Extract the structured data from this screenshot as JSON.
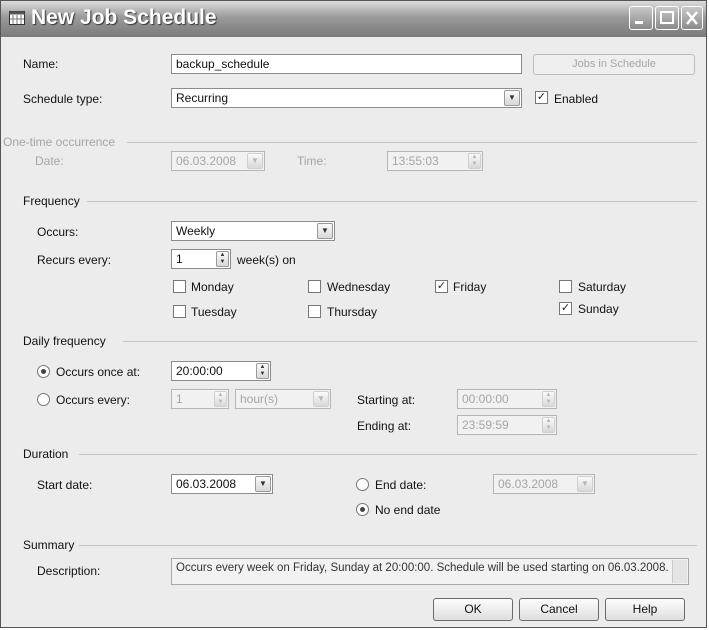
{
  "window": {
    "title": "New Job Schedule"
  },
  "general": {
    "name_label": "Name:",
    "name_value": "backup_schedule",
    "jobs_button": "Jobs in Schedule",
    "schedule_type_label": "Schedule type:",
    "schedule_type_value": "Recurring",
    "enabled_label": "Enabled",
    "enabled_checked": "✓"
  },
  "onetime": {
    "header": "One-time occurrence",
    "date_label": "Date:",
    "date_value": "06.03.2008",
    "time_label": "Time:",
    "time_value": "13:55:03"
  },
  "frequency": {
    "header": "Frequency",
    "occurs_label": "Occurs:",
    "occurs_value": "Weekly",
    "recurs_label": "Recurs every:",
    "recurs_value": "1",
    "recurs_unit": "week(s) on",
    "days": {
      "monday": "Monday",
      "monday_check": "",
      "tuesday": "Tuesday",
      "tuesday_check": "",
      "wednesday": "Wednesday",
      "wednesday_check": "",
      "thursday": "Thursday",
      "thursday_check": "",
      "friday": "Friday",
      "friday_check": "✓",
      "saturday": "Saturday",
      "saturday_check": "",
      "sunday": "Sunday",
      "sunday_check": "✓"
    }
  },
  "daily": {
    "header": "Daily frequency",
    "once_label": "Occurs once at:",
    "once_value": "20:00:00",
    "every_label": "Occurs every:",
    "every_value": "1",
    "every_unit": "hour(s)",
    "starting_label": "Starting at:",
    "starting_value": "00:00:00",
    "ending_label": "Ending at:",
    "ending_value": "23:59:59"
  },
  "duration": {
    "header": "Duration",
    "start_label": "Start date:",
    "start_value": "06.03.2008",
    "end_label": "End date:",
    "end_value": "06.03.2008",
    "no_end_label": "No end date"
  },
  "summary": {
    "header": "Summary",
    "description_label": "Description:",
    "description_value": "Occurs every week on Friday, Sunday at 20:00:00. Schedule will be used starting on 06.03.2008."
  },
  "buttons": {
    "ok": "OK",
    "cancel": "Cancel",
    "help": "Help"
  },
  "colors": {
    "titlebar": "#8a8a8a",
    "window_bg": "#ececec",
    "disabled_text": "#a5a5a5"
  }
}
